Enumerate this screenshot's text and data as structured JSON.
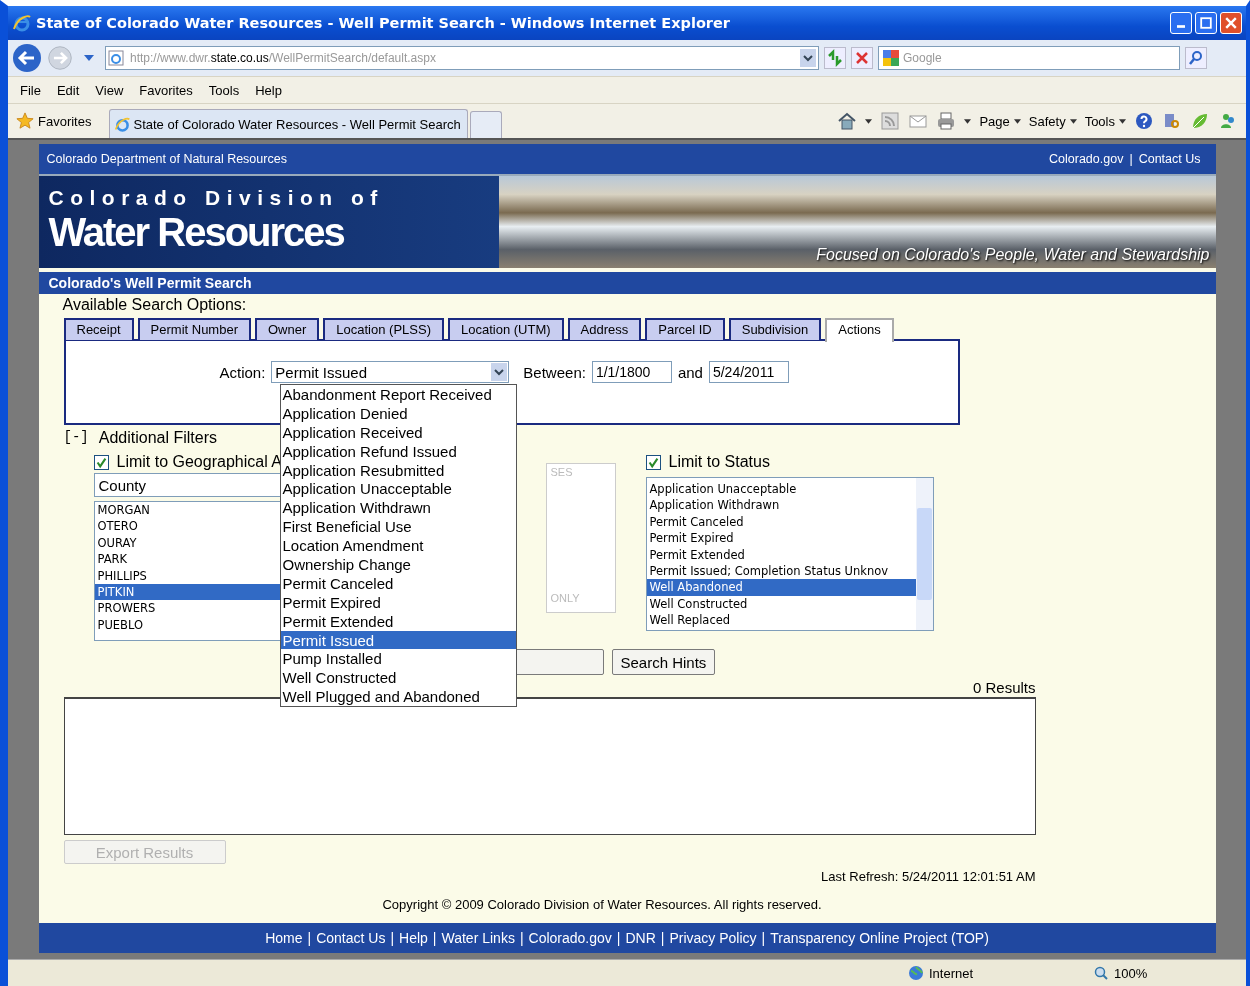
{
  "window": {
    "title": "State of Colorado Water Resources - Well Permit Search - Windows Internet Explorer"
  },
  "address_bar": {
    "url_prefix": "http://www.dwr.",
    "url_domain": "state.co.us",
    "url_path": "/WellPermitSearch/default.aspx",
    "search_placeholder": "Google"
  },
  "menu": [
    "File",
    "Edit",
    "View",
    "Favorites",
    "Tools",
    "Help"
  ],
  "favorites_bar": {
    "favorites": "Favorites",
    "tab_title": "State of Colorado Water Resources - Well Permit Search",
    "commands": [
      "Page",
      "Safety",
      "Tools"
    ]
  },
  "page": {
    "top_strip": {
      "department": "Colorado Department of Natural Resources",
      "links": [
        "Colorado.gov",
        "Contact Us"
      ],
      "separator": "|"
    },
    "banner": {
      "line1": "Colorado Division of",
      "line2": "Water Resources",
      "tagline": "Focused on Colorado's People, Water and Stewardship"
    },
    "section_title": "Colorado's Well Permit Search",
    "search_options_label": "Available Search Options:",
    "tabs": [
      {
        "label": "Receipt",
        "selected": false
      },
      {
        "label": "Permit Number",
        "selected": false
      },
      {
        "label": "Owner",
        "selected": false
      },
      {
        "label": "Location (PLSS)",
        "selected": false
      },
      {
        "label": "Location (UTM)",
        "selected": false
      },
      {
        "label": "Address",
        "selected": false
      },
      {
        "label": "Parcel ID",
        "selected": false
      },
      {
        "label": "Subdivision",
        "selected": false
      },
      {
        "label": "Actions",
        "selected": true
      }
    ],
    "action": {
      "label": "Action:",
      "value": "Permit Issued",
      "between_label": "Between:",
      "from": "1/1/1800",
      "and_label": "and",
      "to": "5/24/2011",
      "options": [
        {
          "label": "Abandonment Report Received",
          "selected": false
        },
        {
          "label": "Application Denied",
          "selected": false
        },
        {
          "label": "Application Received",
          "selected": false
        },
        {
          "label": "Application Refund Issued",
          "selected": false
        },
        {
          "label": "Application Resubmitted",
          "selected": false
        },
        {
          "label": "Application Unacceptable",
          "selected": false
        },
        {
          "label": "Application Withdrawn",
          "selected": false
        },
        {
          "label": "First Beneficial Use",
          "selected": false
        },
        {
          "label": "Location Amendment",
          "selected": false
        },
        {
          "label": "Ownership Change",
          "selected": false
        },
        {
          "label": "Permit Canceled",
          "selected": false
        },
        {
          "label": "Permit Expired",
          "selected": false
        },
        {
          "label": "Permit Extended",
          "selected": false
        },
        {
          "label": "Permit Issued",
          "selected": true
        },
        {
          "label": "Pump Installed",
          "selected": false
        },
        {
          "label": "Well Constructed",
          "selected": false
        },
        {
          "label": "Well Plugged and Abandoned",
          "selected": false
        }
      ]
    },
    "filters": {
      "toggle": "[-]",
      "title": "Additional Filters",
      "geo": {
        "checked": true,
        "label": "Limit to Geographical A",
        "select_value": "County",
        "items": [
          {
            "label": "MORGAN",
            "selected": false
          },
          {
            "label": "OTERO",
            "selected": false
          },
          {
            "label": "OURAY",
            "selected": false
          },
          {
            "label": "PARK",
            "selected": false
          },
          {
            "label": "PHILLIPS",
            "selected": false
          },
          {
            "label": "PITKIN",
            "selected": true
          },
          {
            "label": "PROWERS",
            "selected": false
          },
          {
            "label": "PUEBLO",
            "selected": false
          }
        ]
      },
      "middle_list": {
        "top_text": "SES",
        "bottom_text": "ONLY"
      },
      "status": {
        "checked": true,
        "label": "Limit to Status",
        "items": [
          {
            "label": "Application Unacceptable",
            "selected": false
          },
          {
            "label": "Application Withdrawn",
            "selected": false
          },
          {
            "label": "Permit Canceled",
            "selected": false
          },
          {
            "label": "Permit Expired",
            "selected": false
          },
          {
            "label": "Permit Extended",
            "selected": false
          },
          {
            "label": "Permit Issued; Completion Status Unknov",
            "selected": false
          },
          {
            "label": "Well Abandoned",
            "selected": true
          },
          {
            "label": "Well Constructed",
            "selected": false
          },
          {
            "label": "Well Replaced",
            "selected": false
          }
        ]
      }
    },
    "search_hints": "Search Hints",
    "results_count": "0 Results",
    "export": {
      "label": "Export Results",
      "disabled": true
    },
    "last_refresh": "Last Refresh: 5/24/2011 12:01:51 AM",
    "copyright": "Copyright © 2009 Colorado Division of Water Resources. All rights reserved.",
    "footer_links": [
      "Home",
      "Contact Us",
      "Help",
      "Water Links",
      "Colorado.gov",
      "DNR",
      "Privacy Policy",
      "Transparency Online Project (TOP)"
    ],
    "footer_separator": "|"
  },
  "status_bar": {
    "zone": "Internet",
    "zoom": "100%"
  }
}
